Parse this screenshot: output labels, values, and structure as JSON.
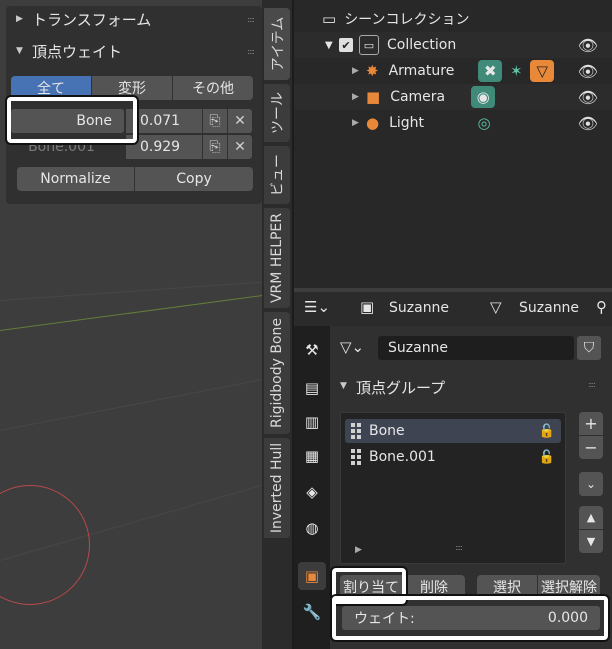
{
  "npanel": {
    "transform_header": "トランスフォーム",
    "vertex_weights_header": "頂点ウェイト",
    "tabs": [
      "全て",
      "変形",
      "その他"
    ],
    "rows": [
      {
        "group": "Bone",
        "weight": "0.071"
      },
      {
        "group": "Bone.001",
        "weight": "0.929"
      }
    ],
    "normalize_label": "Normalize",
    "copy_label": "Copy"
  },
  "side_tabs": [
    "アイテム",
    "ツール",
    "ビュー",
    "VRM HELPER",
    "Rigidbody Bone",
    "Inverted Hull"
  ],
  "outliner": {
    "scene_collection": "シーンコレクション",
    "collection": "Collection",
    "items": [
      "Armature",
      "Camera",
      "Light"
    ]
  },
  "properties": {
    "object_name": "Suzanne",
    "data_name": "Suzanne",
    "mesh_name": "Suzanne",
    "vertex_groups_header": "頂点グループ",
    "groups": [
      "Bone",
      "Bone.001"
    ],
    "assign_label": "割り当て",
    "remove_label": "削除",
    "select_label": "選択",
    "deselect_label": "選択解除",
    "weight_label": "ウェイト:",
    "weight_value": "0.000"
  },
  "colors": {
    "accent": "#4772b3",
    "highlight": "#ffffff",
    "armature": "#e8893a",
    "camera_badge": "#4a8f7e"
  }
}
